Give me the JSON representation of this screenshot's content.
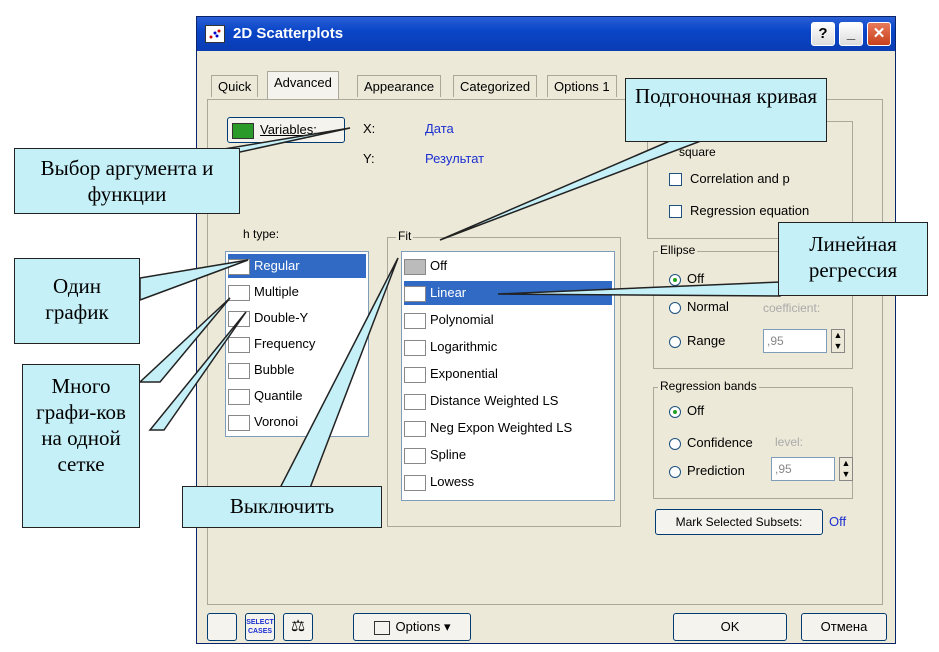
{
  "window": {
    "title": "2D Scatterplots",
    "help_btn": "?",
    "min_btn": "_",
    "close_btn": "✕"
  },
  "tabs": [
    "Quick",
    "Advanced",
    "Appearance",
    "Categorized",
    "Options 1"
  ],
  "variables": {
    "button": "Variables:",
    "x_label": "X:",
    "x_value": "Дата",
    "y_label": "Y:",
    "y_value": "Результат"
  },
  "graph_type": {
    "label": "h type:",
    "items": [
      "Regular",
      "Multiple",
      "Double-Y",
      "Frequency",
      "Bubble",
      "Quantile",
      "Voronoi"
    ],
    "selected": "Regular"
  },
  "fit": {
    "label": "Fit",
    "items": [
      "Off",
      "Linear",
      "Polynomial",
      "Logarithmic",
      "Exponential",
      "Distance Weighted LS",
      "Neg Expon Weighted LS",
      "Spline",
      "Lowess"
    ],
    "selected": "Linear"
  },
  "stats": {
    "r_square": "square",
    "correlation": "Correlation and p",
    "regression_eq": "Regression equation"
  },
  "ellipse": {
    "label": "Ellipse",
    "off": "Off",
    "normal": "Normal",
    "range": "Range",
    "coefficient_label": "coefficient:",
    "coefficient_value": ",95"
  },
  "regression_bands": {
    "label": "Regression bands",
    "off": "Off",
    "confidence": "Confidence",
    "prediction": "Prediction",
    "level_label": "level:",
    "level_value": ",95"
  },
  "mark_selected": {
    "button": "Mark Selected Subsets:",
    "value": "Off"
  },
  "bottom": {
    "select_cases": "SELECT CASES",
    "options": "Options",
    "ok": "OK",
    "cancel": "Отмена"
  },
  "callouts": {
    "fit_curve": "Подгоночная кривая",
    "choose_args": "Выбор аргумента и функции",
    "one_plot": "Один график",
    "linear_regression": "Линейная регрессия",
    "many_plots": "Много графи-ков на одной сетке",
    "turn_off": "Выключить"
  },
  "colors": {
    "accent_blue": "#1b2fd0",
    "callout_bg": "#c6f0f7",
    "selection": "#316ac5"
  }
}
